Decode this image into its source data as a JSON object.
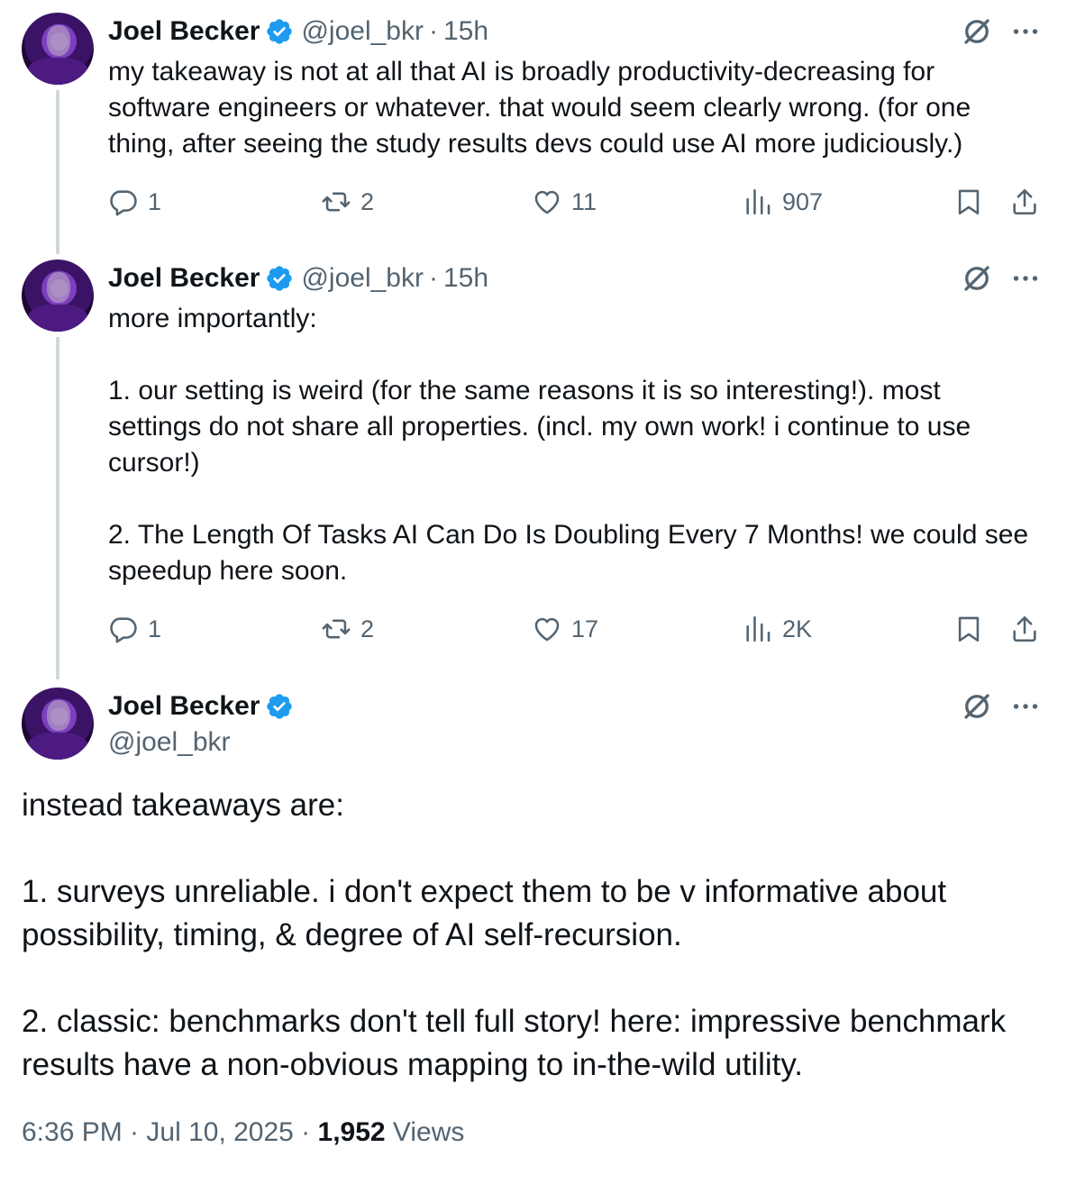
{
  "tweets": [
    {
      "name": "Joel Becker",
      "handle": "@joel_bkr",
      "separator": "·",
      "time": "15h",
      "text": "my takeaway is not at all that AI is broadly productivity-decreasing for\nsoftware engineers or whatever. that would seem clearly wrong. (for one\nthing, after seeing the study results devs could use AI more judiciously.)",
      "replies": "1",
      "reposts": "2",
      "likes": "11",
      "views": "907"
    },
    {
      "name": "Joel Becker",
      "handle": "@joel_bkr",
      "separator": "·",
      "time": "15h",
      "text": "more importantly:\n\n1. our setting is weird (for the same reasons it is so interesting!). most\nsettings do not share all properties. (incl. my own work! i continue to use\ncursor!)\n\n2. The Length Of Tasks AI Can Do Is Doubling Every 7 Months! we could see\nspeedup here soon.",
      "replies": "1",
      "reposts": "2",
      "likes": "17",
      "views": "2K"
    }
  ],
  "main_tweet": {
    "name": "Joel Becker",
    "handle": "@joel_bkr",
    "text": "instead takeaways are:\n\n1. surveys unreliable. i don't expect them to be v informative about\npossibility, timing, & degree of AI self-recursion.\n\n2. classic: benchmarks don't tell full story! here: impressive benchmark\nresults have a non-obvious mapping to in-the-wild utility.",
    "timestamp": "6:36 PM · Jul 10, 2025 · ",
    "view_count": "1,952",
    "views_label": " Views"
  },
  "icons": [
    "verified-badge-icon",
    "grok-icon",
    "more-icon",
    "reply-icon",
    "repost-icon",
    "like-icon",
    "views-icon",
    "bookmark-icon",
    "share-icon"
  ],
  "colors": {
    "text": "#0f1419",
    "secondary": "#536471",
    "verified": "#1d9bf0",
    "thread_line": "#cfd9de"
  }
}
